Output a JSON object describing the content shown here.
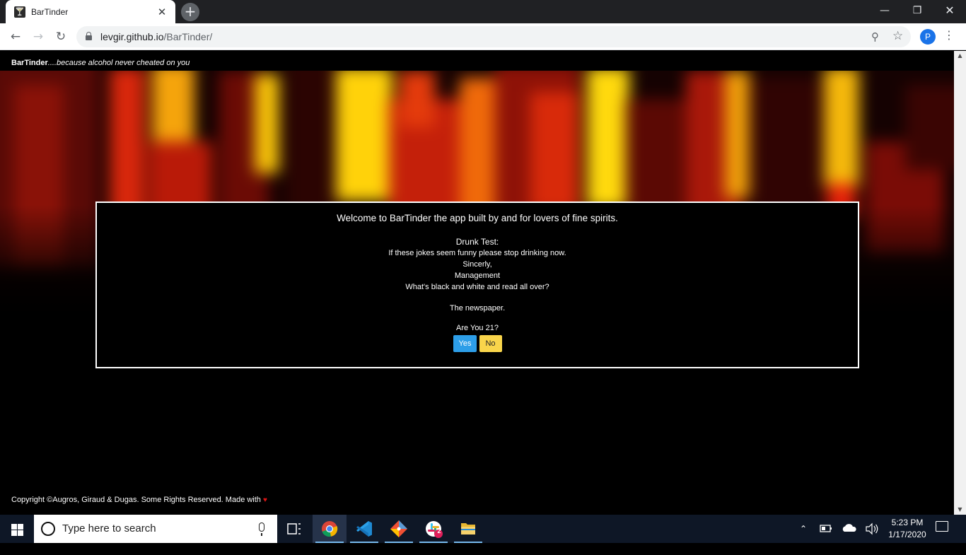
{
  "browser": {
    "tab_title": "BarTinder",
    "tab_close": "✕",
    "new_tab": "+",
    "url_host": "levgir.github.io",
    "url_path": "/BarTinder/",
    "profile_initial": "P"
  },
  "page": {
    "brand_name": "BarTinder",
    "tagline": "....because alcohol never cheated on you",
    "modal": {
      "welcome": "Welcome to BarTinder the app built by and for lovers of fine spirits.",
      "joke_label": "Drunk Test:",
      "joke_lines": [
        "If these jokes seem funny please stop drinking now.",
        "Sincerly,",
        "Management",
        "What's black and white and read all over?"
      ],
      "punchline": "The newspaper.",
      "question": "Are You 21?",
      "yes_label": "Yes",
      "no_label": "No"
    },
    "footer": "Copyright ©Augros, Giraud & Dugas. Some Rights Reserved. Made with",
    "footer_heart": "♥"
  },
  "taskbar": {
    "search_placeholder": "Type here to search",
    "slack_badge": "2",
    "time": "5:23 PM",
    "date": "1/17/2020"
  },
  "colors": {
    "yes_button": "#2d9ee8",
    "no_button": "#f9d54b",
    "heart": "#e01515"
  },
  "icons": [
    "back-arrow-icon",
    "forward-arrow-icon",
    "reload-icon",
    "lock-icon",
    "zoom-icon",
    "star-icon",
    "menu-icon",
    "windows-icon",
    "search-icon",
    "mic-icon",
    "task-view-icon",
    "chrome-icon",
    "vscode-icon",
    "git-icon",
    "slack-icon",
    "folder-icon",
    "chevron-up-icon",
    "battery-icon",
    "cloud-icon",
    "volume-icon",
    "notification-icon"
  ]
}
